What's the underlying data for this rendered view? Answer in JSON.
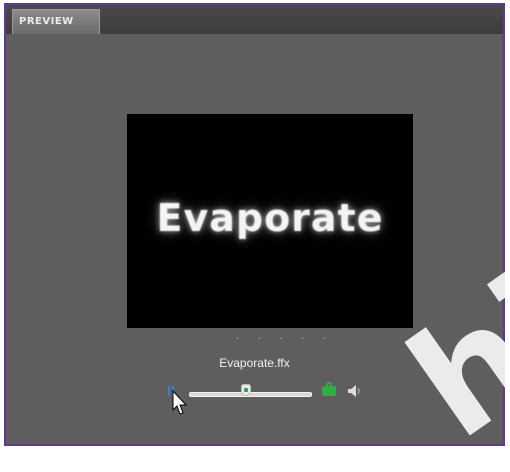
{
  "panel": {
    "tab_label": "PREVIEW"
  },
  "preview": {
    "text": "Evaporate",
    "background_color": "#000000"
  },
  "indicator_dots": ". . . . .",
  "file": {
    "name": "Evaporate.ffx"
  },
  "playback": {
    "state": "paused",
    "position_fraction": 0.46
  },
  "colors": {
    "frame_border": "#5d3a8a",
    "panel_bg": "#5e5e5e",
    "accent_green": "#2eae3f",
    "pause_blue": "#3a7fd6"
  },
  "icons": [
    "pause-icon",
    "loop-icon",
    "speaker-icon",
    "mouse-cursor"
  ]
}
